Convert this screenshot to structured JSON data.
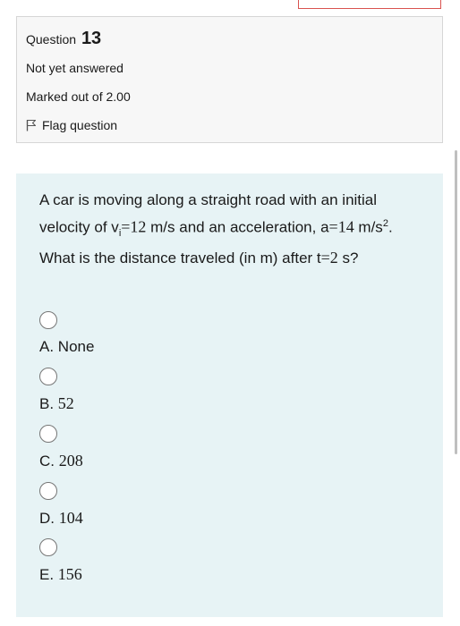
{
  "question": {
    "label": "Question",
    "number": "13",
    "state": "Not yet answered",
    "grade": "Marked out of 2.00",
    "flag_label": "Flag question"
  },
  "prompt": {
    "part1": "A car is moving along a straight road with an initial velocity of v",
    "sub_i": "i",
    "eq1": "=",
    "v_value": "12",
    "part2": " m/s and an acceleration, a",
    "eq2": "=",
    "a_value": "14",
    "part3": " m/s",
    "sup2": "2",
    "part4": ". What is the distance traveled (in m) after t",
    "eq3": "=",
    "t_value": "2",
    "part5": " s?"
  },
  "options": [
    {
      "letter": "A. ",
      "value": "None"
    },
    {
      "letter": "B. ",
      "value": "52"
    },
    {
      "letter": "C. ",
      "value": "208"
    },
    {
      "letter": "D. ",
      "value": "104"
    },
    {
      "letter": "E. ",
      "value": "156"
    }
  ]
}
